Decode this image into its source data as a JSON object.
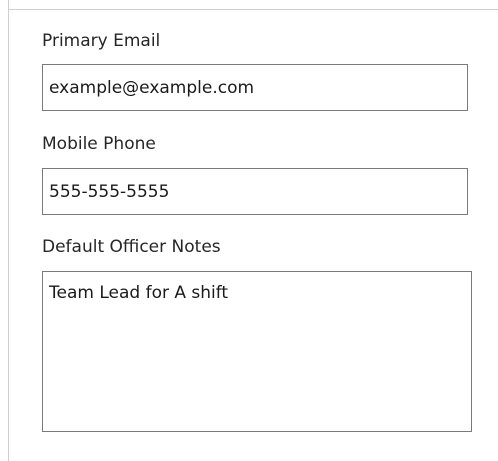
{
  "form": {
    "primary_email": {
      "label": "Primary Email",
      "value": "example@example.com"
    },
    "mobile_phone": {
      "label": "Mobile Phone",
      "value": "555-555-5555"
    },
    "default_officer_notes": {
      "label": "Default Officer Notes",
      "value": "Team Lead for A shift"
    }
  },
  "colors": {
    "background": "#ffffff",
    "input_border": "#7a7a7a",
    "panel_border": "#cfcfcf",
    "text": "#1f1f1f"
  }
}
